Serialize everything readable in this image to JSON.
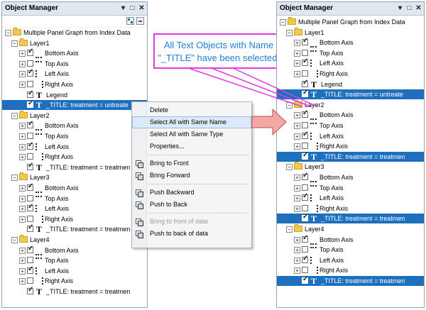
{
  "left_panel": {
    "title": "Object Manager",
    "controls": [
      "▾",
      "□",
      "✕"
    ],
    "rows": [
      {
        "kind": "root",
        "label": "Multiple Panel Graph from Index Data"
      },
      {
        "kind": "layer",
        "label": "Layer1"
      },
      {
        "kind": "axis",
        "icon": "bottom-axis-icon",
        "label": "Bottom Axis",
        "checked": true,
        "exp": "+"
      },
      {
        "kind": "axis",
        "icon": "top-axis-icon",
        "label": "Top Axis",
        "checked": false,
        "exp": "+"
      },
      {
        "kind": "axis",
        "icon": "left-axis-icon",
        "label": "Left Axis",
        "checked": true,
        "exp": "+"
      },
      {
        "kind": "axis",
        "icon": "right-axis-icon",
        "label": "Right Axis",
        "checked": false,
        "exp": "+"
      },
      {
        "kind": "text",
        "label": "Legend",
        "checked": true
      },
      {
        "kind": "text",
        "label": "_TITLE: treatment = untreate",
        "checked": true,
        "selected": true
      },
      {
        "kind": "layer",
        "label": "Layer2"
      },
      {
        "kind": "axis",
        "icon": "bottom-axis-icon",
        "label": "Bottom Axis",
        "checked": true,
        "exp": "+"
      },
      {
        "kind": "axis",
        "icon": "top-axis-icon",
        "label": "Top Axis",
        "checked": false,
        "exp": "+"
      },
      {
        "kind": "axis",
        "icon": "left-axis-icon",
        "label": "Left Axis",
        "checked": true,
        "exp": "+"
      },
      {
        "kind": "axis",
        "icon": "right-axis-icon",
        "label": "Right Axis",
        "checked": false,
        "exp": "+"
      },
      {
        "kind": "text",
        "label": "_TITLE: treatment = treatmen",
        "checked": true
      },
      {
        "kind": "layer",
        "label": "Layer3"
      },
      {
        "kind": "axis",
        "icon": "bottom-axis-icon",
        "label": "Bottom Axis",
        "checked": true,
        "exp": "+"
      },
      {
        "kind": "axis",
        "icon": "top-axis-icon",
        "label": "Top Axis",
        "checked": false,
        "exp": "+"
      },
      {
        "kind": "axis",
        "icon": "left-axis-icon",
        "label": "Left Axis",
        "checked": true,
        "exp": "+"
      },
      {
        "kind": "axis",
        "icon": "right-axis-icon",
        "label": "Right Axis",
        "checked": false,
        "exp": "+"
      },
      {
        "kind": "text",
        "label": "_TITLE: treatment = treatmen",
        "checked": true
      },
      {
        "kind": "layer",
        "label": "Layer4"
      },
      {
        "kind": "axis",
        "icon": "bottom-axis-icon",
        "label": "Bottom Axis",
        "checked": true,
        "exp": "+"
      },
      {
        "kind": "axis",
        "icon": "top-axis-icon",
        "label": "Top Axis",
        "checked": false,
        "exp": "+"
      },
      {
        "kind": "axis",
        "icon": "left-axis-icon",
        "label": "Left Axis",
        "checked": true,
        "exp": "+"
      },
      {
        "kind": "axis",
        "icon": "right-axis-icon",
        "label": "Right Axis",
        "checked": false,
        "exp": "+"
      },
      {
        "kind": "text",
        "label": "_TITLE: treatment = treatmen",
        "checked": true
      }
    ]
  },
  "right_panel": {
    "title": "Object Manager",
    "controls": [
      "▾",
      "□",
      "✕"
    ],
    "rows": [
      {
        "kind": "root",
        "label": "Multiple Panel Graph from Index Data"
      },
      {
        "kind": "layer",
        "label": "Layer1"
      },
      {
        "kind": "axis",
        "icon": "bottom-axis-icon",
        "label": "Bottom Axis",
        "checked": true,
        "exp": "+"
      },
      {
        "kind": "axis",
        "icon": "top-axis-icon",
        "label": "Top Axis",
        "checked": false,
        "exp": "+"
      },
      {
        "kind": "axis",
        "icon": "left-axis-icon",
        "label": "Left Axis",
        "checked": true,
        "exp": "+"
      },
      {
        "kind": "axis",
        "icon": "right-axis-icon",
        "label": "Right Axis",
        "checked": false,
        "exp": "+"
      },
      {
        "kind": "text",
        "label": "Legend",
        "checked": true
      },
      {
        "kind": "text",
        "label": "_TITLE: treatment = untreate",
        "checked": true,
        "selected": true
      },
      {
        "kind": "layer",
        "label": "Layer2"
      },
      {
        "kind": "axis",
        "icon": "bottom-axis-icon",
        "label": "Bottom Axis",
        "checked": true,
        "exp": "+"
      },
      {
        "kind": "axis",
        "icon": "top-axis-icon",
        "label": "Top Axis",
        "checked": false,
        "exp": "+"
      },
      {
        "kind": "axis",
        "icon": "left-axis-icon",
        "label": "Left Axis",
        "checked": true,
        "exp": "+"
      },
      {
        "kind": "axis",
        "icon": "right-axis-icon",
        "label": "Right Axis",
        "checked": false,
        "exp": "+"
      },
      {
        "kind": "text",
        "label": "_TITLE: treatment = treatmen",
        "checked": true,
        "selected": true
      },
      {
        "kind": "layer",
        "label": "Layer3"
      },
      {
        "kind": "axis",
        "icon": "bottom-axis-icon",
        "label": "Bottom Axis",
        "checked": true,
        "exp": "+"
      },
      {
        "kind": "axis",
        "icon": "top-axis-icon",
        "label": "Top Axis",
        "checked": false,
        "exp": "+"
      },
      {
        "kind": "axis",
        "icon": "left-axis-icon",
        "label": "Left Axis",
        "checked": true,
        "exp": "+"
      },
      {
        "kind": "axis",
        "icon": "right-axis-icon",
        "label": "Right Axis",
        "checked": false,
        "exp": "+"
      },
      {
        "kind": "text",
        "label": "_TITLE: treatment = treatmen",
        "checked": true,
        "selected": true
      },
      {
        "kind": "layer",
        "label": "Layer4"
      },
      {
        "kind": "axis",
        "icon": "bottom-axis-icon",
        "label": "Bottom Axis",
        "checked": true,
        "exp": "+"
      },
      {
        "kind": "axis",
        "icon": "top-axis-icon",
        "label": "Top Axis",
        "checked": false,
        "exp": "+"
      },
      {
        "kind": "axis",
        "icon": "left-axis-icon",
        "label": "Left Axis",
        "checked": true,
        "exp": "+"
      },
      {
        "kind": "axis",
        "icon": "right-axis-icon",
        "label": "Right Axis",
        "checked": false,
        "exp": "+"
      },
      {
        "kind": "text",
        "label": "_TITLE: treatment = treatmen",
        "checked": true,
        "selected": true
      }
    ]
  },
  "context_menu": {
    "items": [
      {
        "label": "Delete",
        "icon": null
      },
      {
        "label": "Select All with Same Name",
        "icon": null,
        "highlighted": true
      },
      {
        "label": "Select All with Same Type",
        "icon": null
      },
      {
        "label": "Properties...",
        "icon": null
      },
      {
        "label": "Bring to Front",
        "icon": "bring-to-front-icon",
        "sep_before": true
      },
      {
        "label": "Bring Forward",
        "icon": "bring-forward-icon"
      },
      {
        "label": "Push Backward",
        "icon": "push-backward-icon",
        "sep_before": true
      },
      {
        "label": "Push to Back",
        "icon": "push-to-back-icon"
      },
      {
        "label": "Bring to front of data",
        "icon": "bring-to-front-of-data-icon",
        "disabled": true,
        "sep_before": true
      },
      {
        "label": "Push to back of data",
        "icon": "push-to-back-of-data-icon"
      }
    ]
  },
  "callout": {
    "line1": "All Text Objects with Name",
    "line2": "\"_TITLE\" have been selected."
  },
  "colors": {
    "selection": "#1f6fbf",
    "callout_border": "#e33ae0",
    "callout_text": "#1f7fd6",
    "arrow_fill": "#f4a7a7",
    "arrow_border": "#c0504d",
    "menu_highlight": "#dbe9f8"
  }
}
